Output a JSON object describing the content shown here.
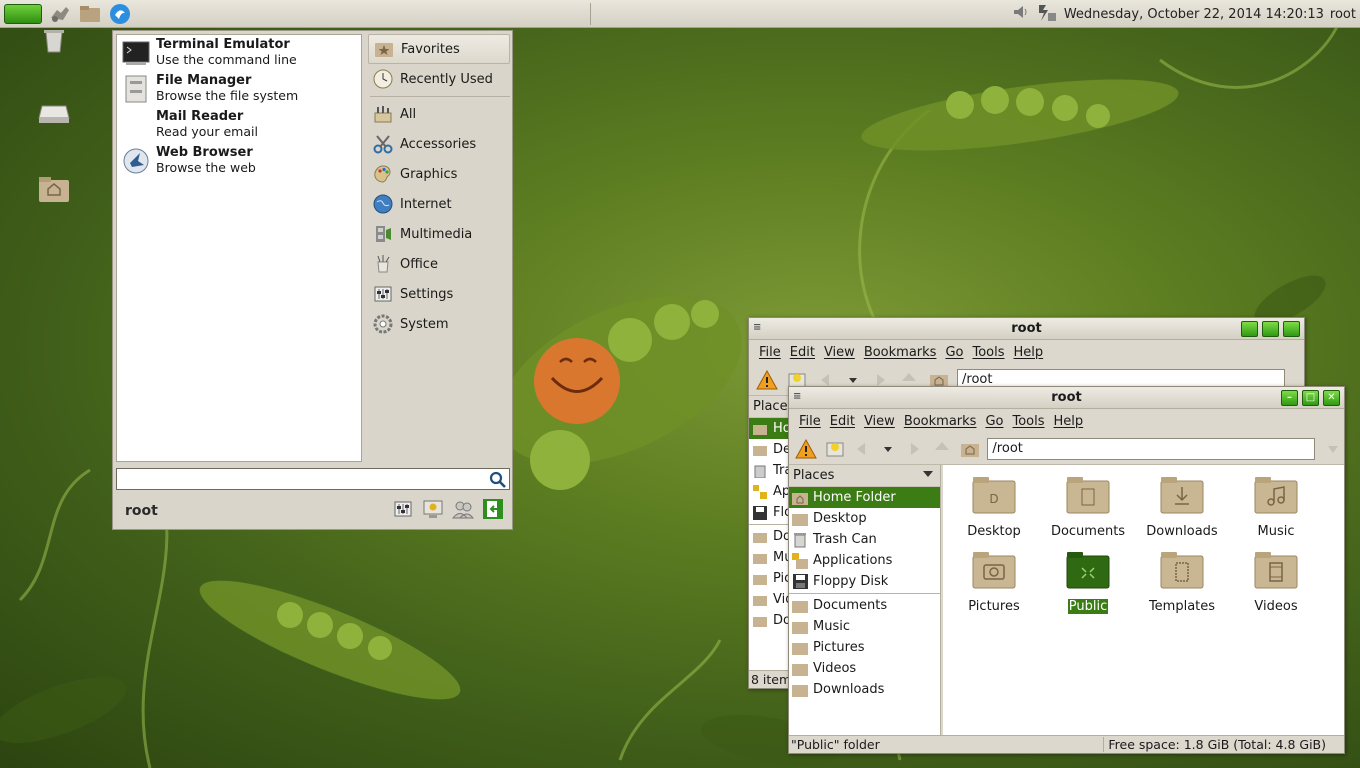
{
  "panel": {
    "clock": "Wednesday, October 22, 2014  14:20:13",
    "user": "root"
  },
  "start_menu": {
    "favorites": [
      {
        "title": "Terminal Emulator",
        "desc": "Use the command line",
        "icon": "terminal-icon"
      },
      {
        "title": "File Manager",
        "desc": "Browse the file system",
        "icon": "file-cabinet-icon"
      },
      {
        "title": "Mail Reader",
        "desc": "Read your email",
        "icon": "mail-icon"
      },
      {
        "title": "Web Browser",
        "desc": "Browse the web",
        "icon": "globe-icon"
      }
    ],
    "categories": [
      {
        "label": "Favorites",
        "icon": "star-folder-icon"
      },
      {
        "label": "Recently Used",
        "icon": "clock-icon"
      },
      {
        "label": "All",
        "icon": "all-apps-icon"
      },
      {
        "label": "Accessories",
        "icon": "scissors-icon"
      },
      {
        "label": "Graphics",
        "icon": "palette-icon"
      },
      {
        "label": "Internet",
        "icon": "globe-icon"
      },
      {
        "label": "Multimedia",
        "icon": "film-icon"
      },
      {
        "label": "Office",
        "icon": "office-cup-icon"
      },
      {
        "label": "Settings",
        "icon": "settings-panel-icon"
      },
      {
        "label": "System",
        "icon": "gear-icon"
      }
    ],
    "search_value": "",
    "user": "root"
  },
  "back_window": {
    "title": "root",
    "menu": [
      "File",
      "Edit",
      "View",
      "Bookmarks",
      "Go",
      "Tools",
      "Help"
    ],
    "location": "/root",
    "places_label": "Places",
    "places": [
      "Ho",
      "De",
      "Tra",
      "Ap",
      "Flo",
      "Do",
      "Mu",
      "Pic",
      "Vid",
      "Do"
    ],
    "status": "8 item"
  },
  "front_window": {
    "title": "root",
    "menu": [
      "File",
      "Edit",
      "View",
      "Bookmarks",
      "Go",
      "Tools",
      "Help"
    ],
    "location": "/root",
    "places_label": "Places",
    "places_main": [
      "Home Folder",
      "Desktop",
      "Trash Can",
      "Applications",
      "Floppy Disk"
    ],
    "places_bookmarks": [
      "Documents",
      "Music",
      "Pictures",
      "Videos",
      "Downloads"
    ],
    "files": [
      "Desktop",
      "Documents",
      "Downloads",
      "Music",
      "Pictures",
      "Public",
      "Templates",
      "Videos"
    ],
    "selected_file": "Public",
    "status_left": "\"Public\" folder",
    "status_right": "Free space: 1.8 GiB (Total: 4.8 GiB)"
  },
  "colors": {
    "accent": "#3c7c14",
    "panel": "#dcd8cd",
    "wallpaper": "#4f6e1c"
  }
}
